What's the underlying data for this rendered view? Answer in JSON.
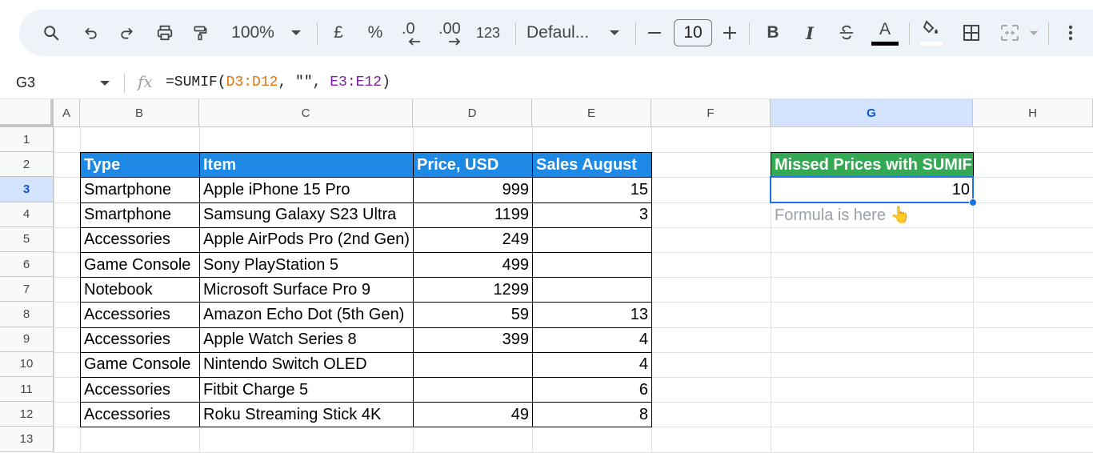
{
  "toolbar": {
    "zoom": "100%",
    "currency": "£",
    "percent": "%",
    "decrease_decimal": ".0",
    "increase_decimal": ".00",
    "number_format": "123",
    "font_family": "Defaul...",
    "font_size": "10",
    "minus": "−",
    "plus": "+",
    "bold": "B",
    "italic": "I",
    "text_color_letter": "A",
    "icons": [
      "search-icon",
      "undo-icon",
      "redo-icon",
      "print-icon",
      "paint-format-icon",
      "chevron-down-icon",
      "minus-icon",
      "plus-icon",
      "strikethrough-icon",
      "fill-color-icon",
      "borders-icon",
      "merge-cells-icon",
      "more-vert-icon"
    ]
  },
  "formula_bar": {
    "name_box": "G3",
    "fx": "fx",
    "formula_prefix": "=SUMIF(",
    "formula_range1": "D3:D12",
    "formula_mid": ", \"\", ",
    "formula_range2": "E3:E12",
    "formula_suffix": ")"
  },
  "columns": [
    "A",
    "B",
    "C",
    "D",
    "E",
    "F",
    "G",
    "H"
  ],
  "rows": [
    "1",
    "2",
    "3",
    "4",
    "5",
    "6",
    "7",
    "8",
    "9",
    "10",
    "11",
    "12",
    "13"
  ],
  "table": {
    "headers": [
      "Type",
      "Item",
      "Price, USD",
      "Sales August"
    ],
    "rows": [
      [
        "Smartphone",
        "Apple iPhone 15 Pro",
        "999",
        "15"
      ],
      [
        "Smartphone",
        "Samsung Galaxy S23 Ultra",
        "1199",
        "3"
      ],
      [
        "Accessories",
        "Apple AirPods Pro (2nd Gen)",
        "249",
        ""
      ],
      [
        "Game Console",
        "Sony PlayStation 5",
        "499",
        ""
      ],
      [
        "Notebook",
        "Microsoft Surface Pro 9",
        "1299",
        ""
      ],
      [
        "Accessories",
        "Amazon Echo Dot (5th Gen)",
        "59",
        "13"
      ],
      [
        "Accessories",
        "Apple Watch Series 8",
        "399",
        "4"
      ],
      [
        "Game Console",
        "Nintendo Switch OLED",
        "",
        "4"
      ],
      [
        "Accessories",
        "Fitbit Charge 5",
        "",
        "6"
      ],
      [
        "Accessories",
        "Roku Streaming Stick 4K",
        "49",
        "8"
      ]
    ]
  },
  "summary": {
    "header": "Missed Prices with SUMIF",
    "value": "10",
    "note": "Formula is here 👆"
  },
  "selection": {
    "cell": "G3",
    "column": "G",
    "row": "3"
  },
  "colors": {
    "table_header": "#1e88e5",
    "summary_header": "#34a853",
    "selection": "#1a73e8"
  }
}
